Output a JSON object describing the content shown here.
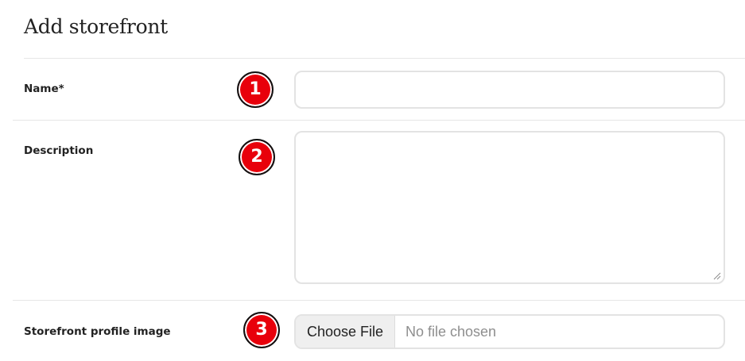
{
  "page": {
    "title": "Add storefront"
  },
  "fields": {
    "name": {
      "label": "Name*",
      "value": "",
      "placeholder": "",
      "step": "1"
    },
    "description": {
      "label": "Description",
      "value": "",
      "placeholder": "",
      "step": "2"
    },
    "profile_image": {
      "label": "Storefront profile image",
      "button_label": "Choose File",
      "status": "No file chosen",
      "step": "3"
    }
  },
  "colors": {
    "badge": "#e8000b",
    "border": "#e3e3e3",
    "divider": "#e6e6e6"
  }
}
